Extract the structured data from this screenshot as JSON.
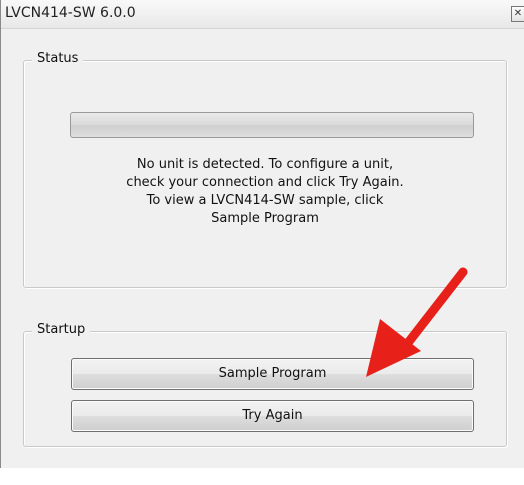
{
  "window": {
    "title": "LVCN414-SW 6.0.0",
    "close_glyph": "✕"
  },
  "status_group": {
    "legend": "Status",
    "progress": 0,
    "message_lines": [
      "No unit is detected.  To configure a unit,",
      "check your connection and click Try Again.",
      "To view a LVCN414-SW sample, click",
      "Sample Program"
    ]
  },
  "startup_group": {
    "legend": "Startup",
    "sample_button_label": "Sample Program",
    "try_again_button_label": "Try Again"
  },
  "annotation": {
    "arrow_color": "#e8201a",
    "arrow_icon": "red-arrow-icon"
  }
}
